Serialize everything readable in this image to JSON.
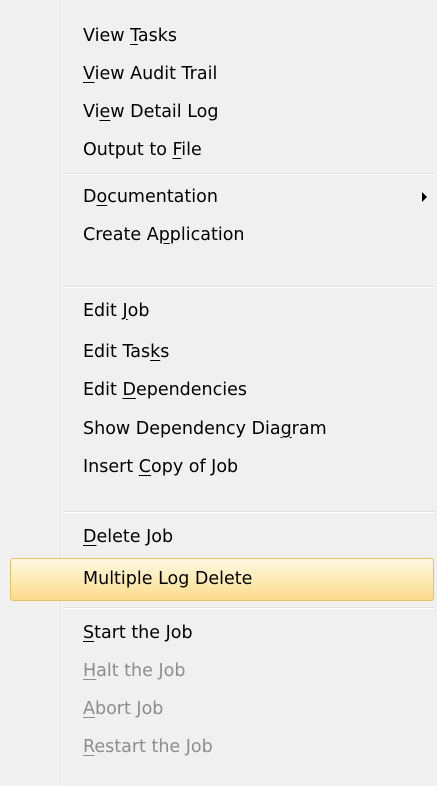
{
  "menu": {
    "items": [
      {
        "id": "view-tasks",
        "pre": "View ",
        "u": "T",
        "post": "asks",
        "enabled": true
      },
      {
        "id": "view-audit-trail",
        "pre": "",
        "u": "V",
        "post": "iew Audit Trail",
        "enabled": true
      },
      {
        "id": "view-detail-log",
        "pre": "Vi",
        "u": "e",
        "post": "w Detail Log",
        "enabled": true
      },
      {
        "id": "output-to-file",
        "pre": "Output to ",
        "u": "F",
        "post": "ile",
        "enabled": true
      },
      {
        "id": "documentation",
        "pre": "D",
        "u": "o",
        "post": "cumentation",
        "enabled": true,
        "submenu": true
      },
      {
        "id": "create-application",
        "pre": "Create A",
        "u": "p",
        "post": "plication",
        "enabled": true
      },
      {
        "id": "edit-job",
        "pre": "Edit ",
        "u": "J",
        "post": "ob",
        "enabled": true
      },
      {
        "id": "edit-tasks",
        "pre": "Edit Tas",
        "u": "k",
        "post": "s",
        "enabled": true
      },
      {
        "id": "edit-dependencies",
        "pre": "Edit ",
        "u": "D",
        "post": "ependencies",
        "enabled": true
      },
      {
        "id": "show-dependency-diagram",
        "pre": "Show Dependency Dia",
        "u": "g",
        "post": "ram",
        "enabled": true
      },
      {
        "id": "insert-copy-of-job",
        "pre": "Insert ",
        "u": "C",
        "post": "opy of Job",
        "enabled": true
      },
      {
        "id": "delete-job",
        "pre": "",
        "u": "D",
        "post": "elete Job",
        "enabled": true
      },
      {
        "id": "multiple-log-delete",
        "pre": "Multiple Log Delete",
        "u": "",
        "post": "",
        "enabled": true,
        "highlighted": true
      },
      {
        "id": "start-the-job",
        "pre": "",
        "u": "S",
        "post": "tart the Job",
        "enabled": true
      },
      {
        "id": "halt-the-job",
        "pre": "",
        "u": "H",
        "post": "alt the Job",
        "enabled": false
      },
      {
        "id": "abort-job",
        "pre": "",
        "u": "A",
        "post": "bort Job",
        "enabled": false
      },
      {
        "id": "restart-the-job",
        "pre": "",
        "u": "R",
        "post": "estart the Job",
        "enabled": false
      }
    ]
  }
}
